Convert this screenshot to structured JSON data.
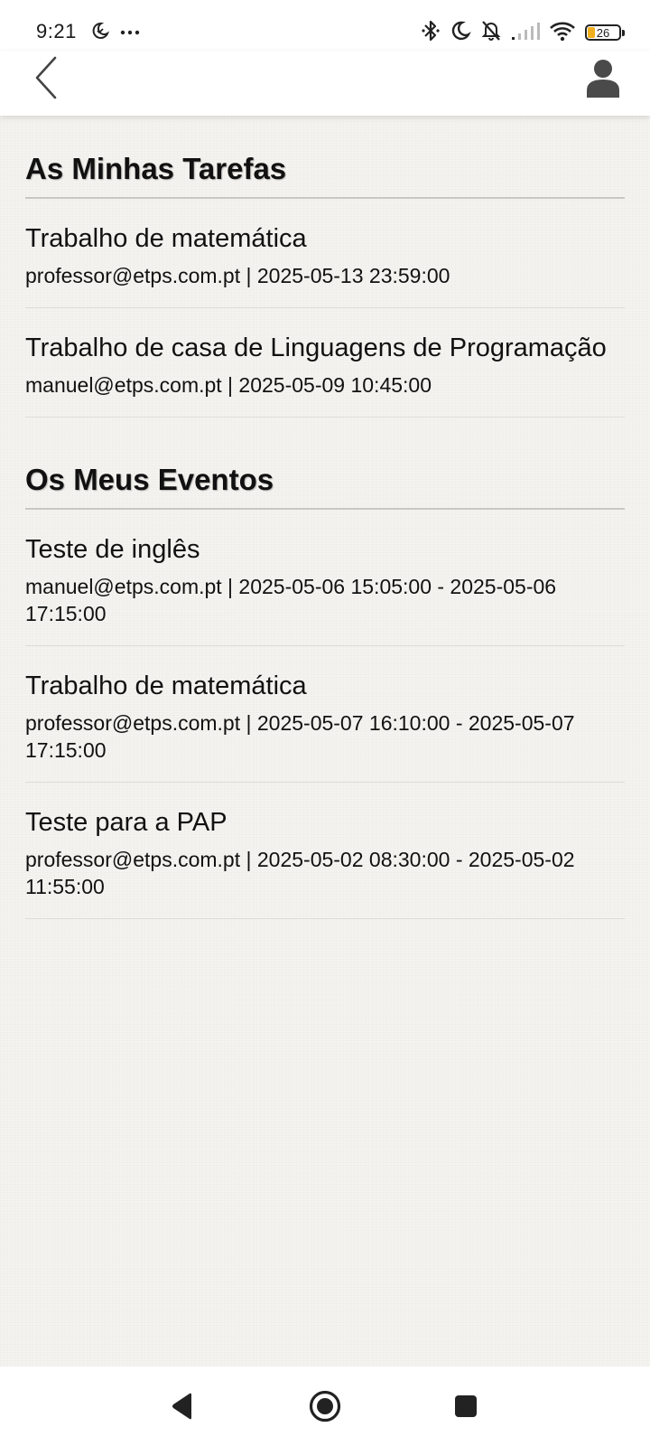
{
  "status_bar": {
    "time": "9:21",
    "battery": "26",
    "left_icons": [
      "sleep-timer-icon",
      "more-dots-icon"
    ],
    "right_icons": [
      "bluetooth-icon",
      "moon-icon",
      "bell-off-icon",
      "signal-icon",
      "wifi-icon",
      "battery-icon"
    ]
  },
  "header": {
    "back_icon": "chevron-left-icon",
    "profile_icon": "user-icon"
  },
  "tasks": {
    "title": "As Minhas Tarefas",
    "items": [
      {
        "title": "Trabalho de matemática",
        "meta": "professor@etps.com.pt | 2025-05-13 23:59:00"
      },
      {
        "title": "Trabalho de casa de Linguagens de Programação",
        "meta": "manuel@etps.com.pt | 2025-05-09 10:45:00"
      }
    ]
  },
  "events": {
    "title": "Os Meus Eventos",
    "items": [
      {
        "title": "Teste de inglês",
        "meta": "manuel@etps.com.pt | 2025-05-06 15:05:00 - 2025-05-06 17:15:00"
      },
      {
        "title": "Trabalho de matemática",
        "meta": "professor@etps.com.pt | 2025-05-07 16:10:00 - 2025-05-07 17:15:00"
      },
      {
        "title": "Teste para a PAP",
        "meta": "professor@etps.com.pt | 2025-05-02 08:30:00 - 2025-05-02 11:55:00"
      }
    ]
  },
  "nav_bar": {
    "icons": [
      "nav-back-icon",
      "nav-home-icon",
      "nav-recents-icon"
    ]
  },
  "colors": {
    "background": "#f4f3ef",
    "header_background": "#ffffff",
    "text": "#111111",
    "divider": "#c8c7c3",
    "battery_fill": "#f2b01e"
  }
}
